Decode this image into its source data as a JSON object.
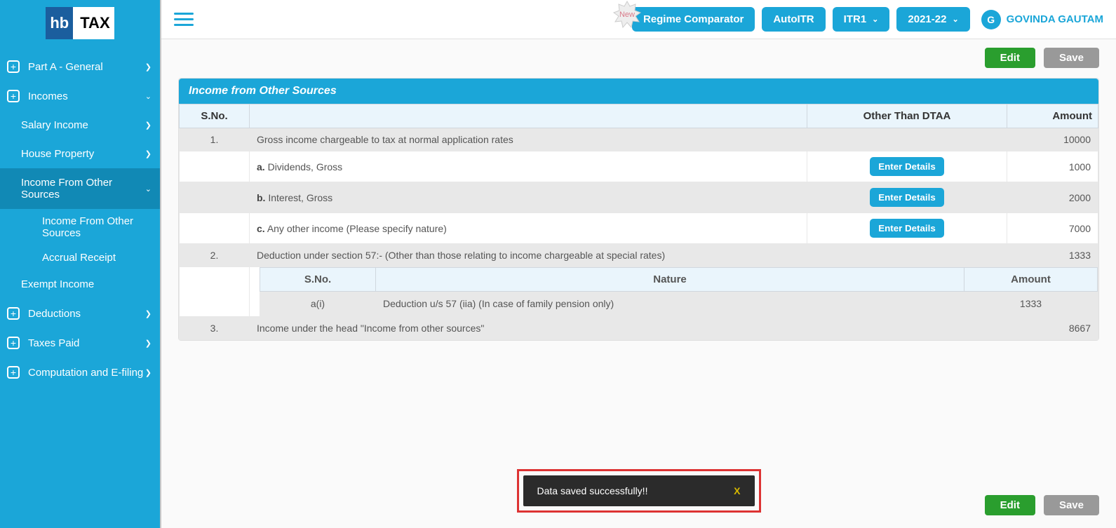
{
  "logo": {
    "left": "hb",
    "right": "TAX"
  },
  "sidebar": {
    "items": [
      {
        "label": "Part A - General"
      },
      {
        "label": "Incomes"
      },
      {
        "label": "Deductions"
      },
      {
        "label": "Taxes Paid"
      },
      {
        "label": "Computation and E-filing"
      }
    ],
    "incomes_sub": [
      {
        "label": "Salary Income"
      },
      {
        "label": "House Property"
      },
      {
        "label": "Income From Other Sources"
      },
      {
        "label": "Exempt Income"
      }
    ],
    "ifos_sub": [
      {
        "label": "Income From Other Sources"
      },
      {
        "label": "Accrual Receipt"
      }
    ]
  },
  "topbar": {
    "new_badge": "New",
    "regime": "Regime Comparator",
    "autoitr": "AutoITR",
    "itr": "ITR1",
    "year": "2021-22"
  },
  "user": {
    "initial": "G",
    "name": "GOVINDA GAUTAM"
  },
  "actions": {
    "edit": "Edit",
    "save": "Save"
  },
  "panel": {
    "title": "Income from Other Sources",
    "headers": {
      "sno": "S.No.",
      "desc": "",
      "dtaa": "Other Than DTAA",
      "amount": "Amount"
    },
    "enter_details": "Enter Details",
    "rows": [
      {
        "sno": "1.",
        "desc": "Gross income chargeable to tax at normal application rates",
        "amount": "10000"
      },
      {
        "prefix": "a.",
        "desc": "Dividends, Gross",
        "amount": "1000",
        "button": true
      },
      {
        "prefix": "b.",
        "desc": "Interest, Gross",
        "amount": "2000",
        "button": true
      },
      {
        "prefix": "c.",
        "desc": "Any other income (Please specify nature)",
        "amount": "7000",
        "button": true
      },
      {
        "sno": "2.",
        "desc": "Deduction under section 57:- (Other than those relating to income chargeable at special rates)",
        "amount": "1333"
      },
      {
        "sno": "3.",
        "desc": "Income under the head \"Income from other sources\"",
        "amount": "8667"
      }
    ],
    "sub_headers": {
      "sno": "S.No.",
      "nature": "Nature",
      "amount": "Amount"
    },
    "sub_rows": [
      {
        "sno": "a(i)",
        "nature": "Deduction u/s 57 (iia) (In case of family pension only)",
        "amount": "1333"
      }
    ]
  },
  "toast": {
    "message": "Data saved successfully!!",
    "close": "X"
  }
}
